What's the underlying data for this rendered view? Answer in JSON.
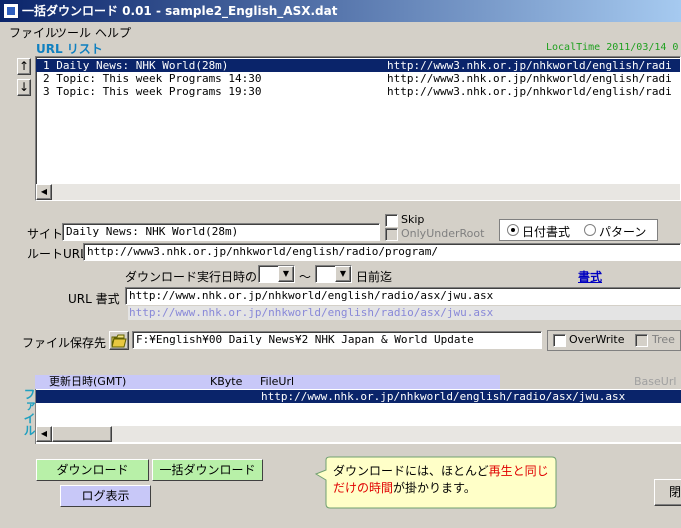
{
  "window": {
    "title": "一括ダウンロード 0.01  -  sample2_English_ASX.dat"
  },
  "menu": [
    "ファイル",
    "ツール",
    "ヘルプ"
  ],
  "url_list": {
    "heading": "URL リスト",
    "local_time": "LocalTime 2011/03/14 0",
    "rows": [
      {
        "title": "1 Daily News: NHK World(28m)",
        "url": "http://www3.nhk.or.jp/nhkworld/english/radi"
      },
      {
        "title": "2 Topic: This week Programs 14:30",
        "url": "http://www3.nhk.or.jp/nhkworld/english/radi"
      },
      {
        "title": "3 Topic: This week Programs 19:30",
        "url": "http://www3.nhk.or.jp/nhkworld/english/radi"
      }
    ],
    "up_arrow": "↑",
    "down_arrow": "↓"
  },
  "site": {
    "label": "サイト",
    "value": "Daily News: NHK World(28m)",
    "skip_label": "Skip",
    "only_under_root_label": "OnlyUnderRoot",
    "date_format_label": "日付書式",
    "pattern_label": "パターン"
  },
  "root_url": {
    "label": "ルートURL",
    "value": "http://www3.nhk.or.jp/nhkworld/english/radio/program/"
  },
  "schedule": {
    "label": "ダウンロード実行日時の",
    "tilde": "～",
    "days_before": "日前迄",
    "format_link": "書式"
  },
  "url_format": {
    "label": "URL 書式",
    "value": "http://www.nhk.or.jp/nhkworld/english/radio/asx/jwu.asx",
    "preview": "http://www.nhk.or.jp/nhkworld/english/radio/asx/jwu.asx"
  },
  "save_dest": {
    "label": "ファイル保存先",
    "value": "F:¥English¥00 Daily News¥2 NHK Japan & World Update",
    "overwrite_label": "OverWrite",
    "tree_label": "Tree"
  },
  "file_list": {
    "side_label": "ファイル",
    "headers": [
      "更新日時(GMT)",
      "KByte",
      "FileUrl",
      "BaseUrl"
    ],
    "rows": [
      {
        "date": "",
        "kbyte": "",
        "url": "http://www.nhk.or.jp/nhkworld/english/radio/asx/jwu.asx"
      }
    ]
  },
  "buttons": {
    "download": "ダウンロード",
    "bulk_download": "一括ダウンロード",
    "log": "ログ表示",
    "close": "閉"
  },
  "tip": {
    "part1": "ダウンロードには、ほとんど",
    "part2": "再生と同じ",
    "part3": "だけの時間",
    "part4": "が掛かります。"
  },
  "colors": {
    "accent_green": "#b8f0a8",
    "accent_blue_btn": "#c8c8f8",
    "selection": "#0a246a",
    "tip_red": "#e00000",
    "tip_bg": "#ffffc8"
  }
}
